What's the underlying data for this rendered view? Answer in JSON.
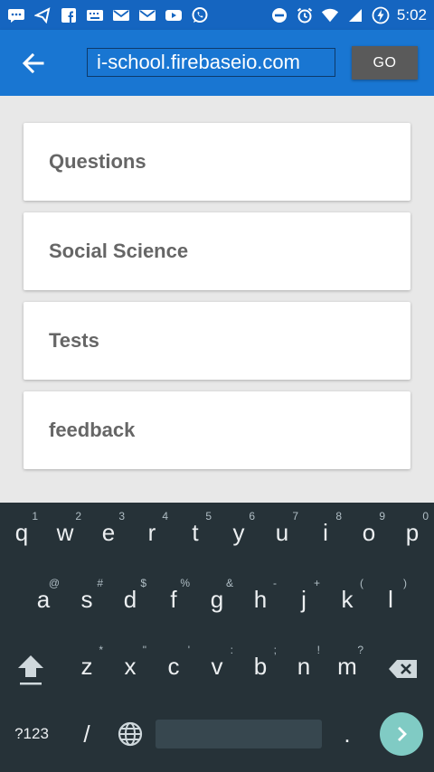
{
  "status_bar": {
    "time": "5:02",
    "left_icons": [
      "message-icon",
      "send-icon",
      "facebook-icon",
      "keyboard-icon",
      "mail-icon",
      "mail-icon",
      "youtube-icon",
      "whatsapp-icon"
    ],
    "right_icons": [
      "do-not-disturb-icon",
      "alarm-icon",
      "wifi-icon",
      "signal-icon",
      "battery-charging-icon"
    ]
  },
  "app_bar": {
    "url_value": "i-school.firebaseio.com",
    "go_label": "GO"
  },
  "list": {
    "items": [
      {
        "label": "Questions"
      },
      {
        "label": "Social Science"
      },
      {
        "label": "Tests"
      },
      {
        "label": "feedback"
      }
    ]
  },
  "keyboard": {
    "row1": [
      {
        "key": "q",
        "hint": "1"
      },
      {
        "key": "w",
        "hint": "2"
      },
      {
        "key": "e",
        "hint": "3"
      },
      {
        "key": "r",
        "hint": "4"
      },
      {
        "key": "t",
        "hint": "5"
      },
      {
        "key": "y",
        "hint": "6"
      },
      {
        "key": "u",
        "hint": "7"
      },
      {
        "key": "i",
        "hint": "8"
      },
      {
        "key": "o",
        "hint": "9"
      },
      {
        "key": "p",
        "hint": "0"
      }
    ],
    "row2": [
      {
        "key": "a",
        "hint": "@"
      },
      {
        "key": "s",
        "hint": "#"
      },
      {
        "key": "d",
        "hint": "$"
      },
      {
        "key": "f",
        "hint": "%"
      },
      {
        "key": "g",
        "hint": "&"
      },
      {
        "key": "h",
        "hint": "-"
      },
      {
        "key": "j",
        "hint": "+"
      },
      {
        "key": "k",
        "hint": "("
      },
      {
        "key": "l",
        "hint": ")"
      }
    ],
    "row3": [
      {
        "key": "z",
        "hint": "*"
      },
      {
        "key": "x",
        "hint": "\""
      },
      {
        "key": "c",
        "hint": "'"
      },
      {
        "key": "v",
        "hint": ":"
      },
      {
        "key": "b",
        "hint": ";"
      },
      {
        "key": "n",
        "hint": "!"
      },
      {
        "key": "m",
        "hint": "?"
      }
    ],
    "symbols_label": "?123",
    "slash_label": "/",
    "period_label": "."
  },
  "colors": {
    "status_bar": "#1565c0",
    "app_bar": "#1976d2",
    "go_button": "#5a5a5a",
    "keyboard_bg": "#263238",
    "enter_key": "#80cbc4",
    "card_text": "#666666"
  }
}
